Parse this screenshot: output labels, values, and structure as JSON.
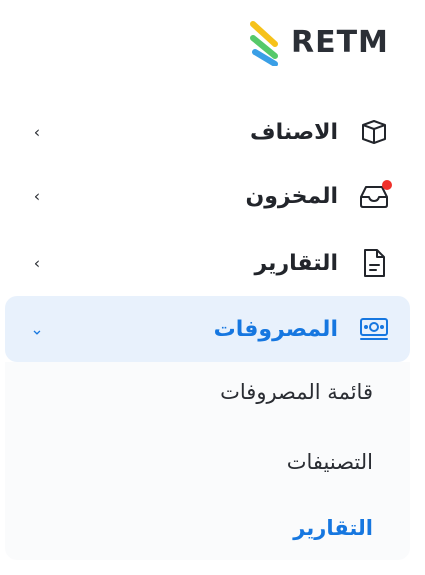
{
  "brand": {
    "name": "RETM"
  },
  "menu": [
    {
      "label": "الاصناف",
      "icon": "box-icon",
      "expanded": false,
      "badge": false
    },
    {
      "label": "المخزون",
      "icon": "inbox-tray-icon",
      "expanded": false,
      "badge": true
    },
    {
      "label": "التقارير",
      "icon": "document-icon",
      "expanded": false,
      "badge": false
    },
    {
      "label": "المصروفات",
      "icon": "money-bills-icon",
      "expanded": true,
      "badge": false
    }
  ],
  "submenu": [
    {
      "label": "قائمة المصروفات",
      "active": false
    },
    {
      "label": "التصنيفات",
      "active": false
    },
    {
      "label": "التقارير",
      "active": true
    }
  ],
  "colors": {
    "accent": "#1677e0",
    "active_bg": "#e8f1fc",
    "badge": "#f0302a",
    "logo_yellow": "#f6c21a",
    "logo_green": "#56c96a",
    "logo_blue": "#3a9fe6"
  }
}
